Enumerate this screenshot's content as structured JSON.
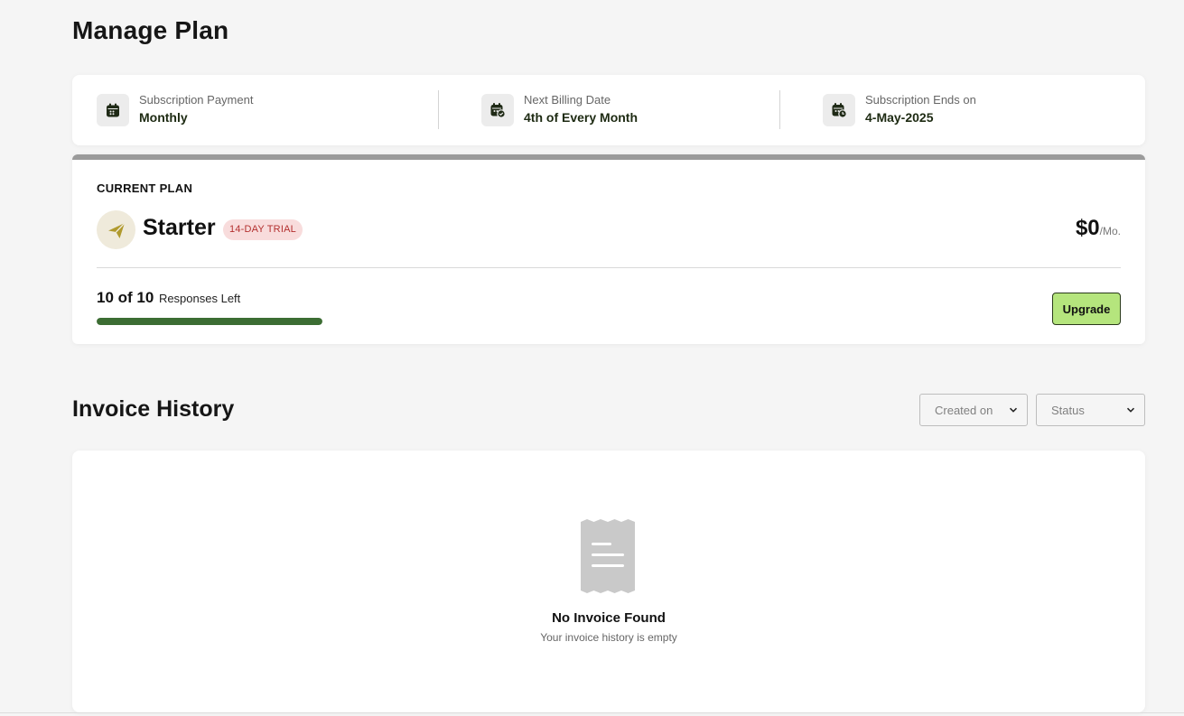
{
  "page": {
    "title": "Manage Plan"
  },
  "summary": {
    "items": [
      {
        "label": "Subscription Payment",
        "value": "Monthly",
        "icon": "calendar-icon"
      },
      {
        "label": "Next Billing Date",
        "value": "4th of Every Month",
        "icon": "calendar-check-icon"
      },
      {
        "label": "Subscription Ends on",
        "value": "4-May-2025",
        "icon": "calendar-clock-icon"
      }
    ]
  },
  "plan": {
    "heading": "CURRENT PLAN",
    "name": "Starter",
    "badge": "14-DAY TRIAL",
    "icon": "paper-plane-icon",
    "price": "$0",
    "price_period": "/Mo.",
    "usage_count": "10 of 10",
    "usage_label": "Responses Left",
    "usage_fraction": 1.0,
    "upgrade_label": "Upgrade"
  },
  "invoices": {
    "title": "Invoice History",
    "filters": [
      {
        "label": "Created on",
        "icon": "chevron-down-icon"
      },
      {
        "label": "Status",
        "icon": "chevron-down-icon"
      }
    ],
    "empty_icon": "receipt-icon",
    "empty_title": "No Invoice Found",
    "empty_subtitle": "Your invoice history is empty"
  },
  "colors": {
    "accent_green": "#b5e57d",
    "progress_green": "#3c6d33",
    "badge_bg": "#f8dcdc",
    "badge_text": "#b3302f",
    "plan_icon": "#b09a2e"
  }
}
